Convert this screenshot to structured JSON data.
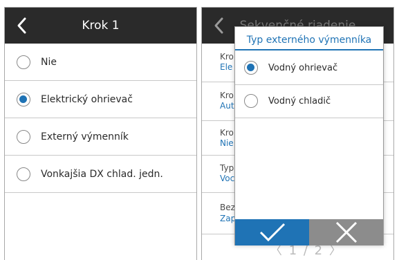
{
  "left_screen": {
    "title": "Krok 1",
    "options": [
      {
        "label": "Nie",
        "checked": false
      },
      {
        "label": "Elektrický ohrievač",
        "checked": true
      },
      {
        "label": "Externý výmenník",
        "checked": false
      },
      {
        "label": "Vonkajšia DX chlad. jedn.",
        "checked": false
      }
    ]
  },
  "right_screen": {
    "title": "Sekvenčné riadenie",
    "bg_items": [
      {
        "title": "Kro",
        "value": "Ele"
      },
      {
        "title": "Kro",
        "value": "Aut"
      },
      {
        "title": "Kro",
        "value": "Nie"
      },
      {
        "title": "Typ",
        "value": "Voc"
      },
      {
        "title": "Bez",
        "value": "Zap"
      }
    ],
    "pager": "〈 1 / 2 〉"
  },
  "dialog": {
    "title": "Typ externého výmenníka",
    "options": [
      {
        "label": "Vodný ohrievač",
        "checked": true
      },
      {
        "label": "Vodný chladič",
        "checked": false
      }
    ],
    "ok_icon": "check-icon",
    "cancel_icon": "close-icon"
  },
  "colors": {
    "header": "#2a2a2a",
    "accent": "#1f73b5",
    "cancel": "#8c8c8c"
  }
}
